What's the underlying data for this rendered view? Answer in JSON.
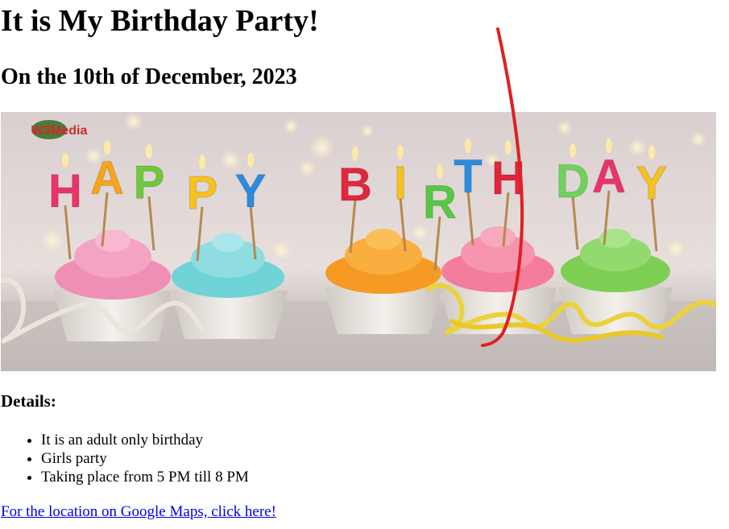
{
  "title": "It is My Birthday Party!",
  "subtitle": "On the 10th of December, 2023",
  "banner": {
    "watermark": "W3Media",
    "letters_left": [
      "H",
      "A",
      "P",
      "P",
      "Y"
    ],
    "letters_right": [
      "B",
      "I",
      "R",
      "T",
      "H",
      "D",
      "A",
      "Y"
    ],
    "letter_colors": [
      "#e8346a",
      "#f7a51c",
      "#6ec93a",
      "#f6c21d",
      "#2a8be0",
      "#e2263b",
      "#f6c21d",
      "#56c843",
      "#2a8be0",
      "#e2263b",
      "#6fd35b",
      "#e8346a",
      "#f6c21d"
    ],
    "frosting_colors": [
      "#f08fb6",
      "#6fd3d8",
      "#f79a24",
      "#f37d9a",
      "#7ccf52"
    ]
  },
  "details": {
    "heading": "Details:",
    "items": [
      "It is an adult only birthday",
      "Girls party",
      "Taking place from 5 PM till 8 PM"
    ]
  },
  "link": {
    "label": "For the location on Google Maps, click here!"
  },
  "annotation_color": "#e02020"
}
